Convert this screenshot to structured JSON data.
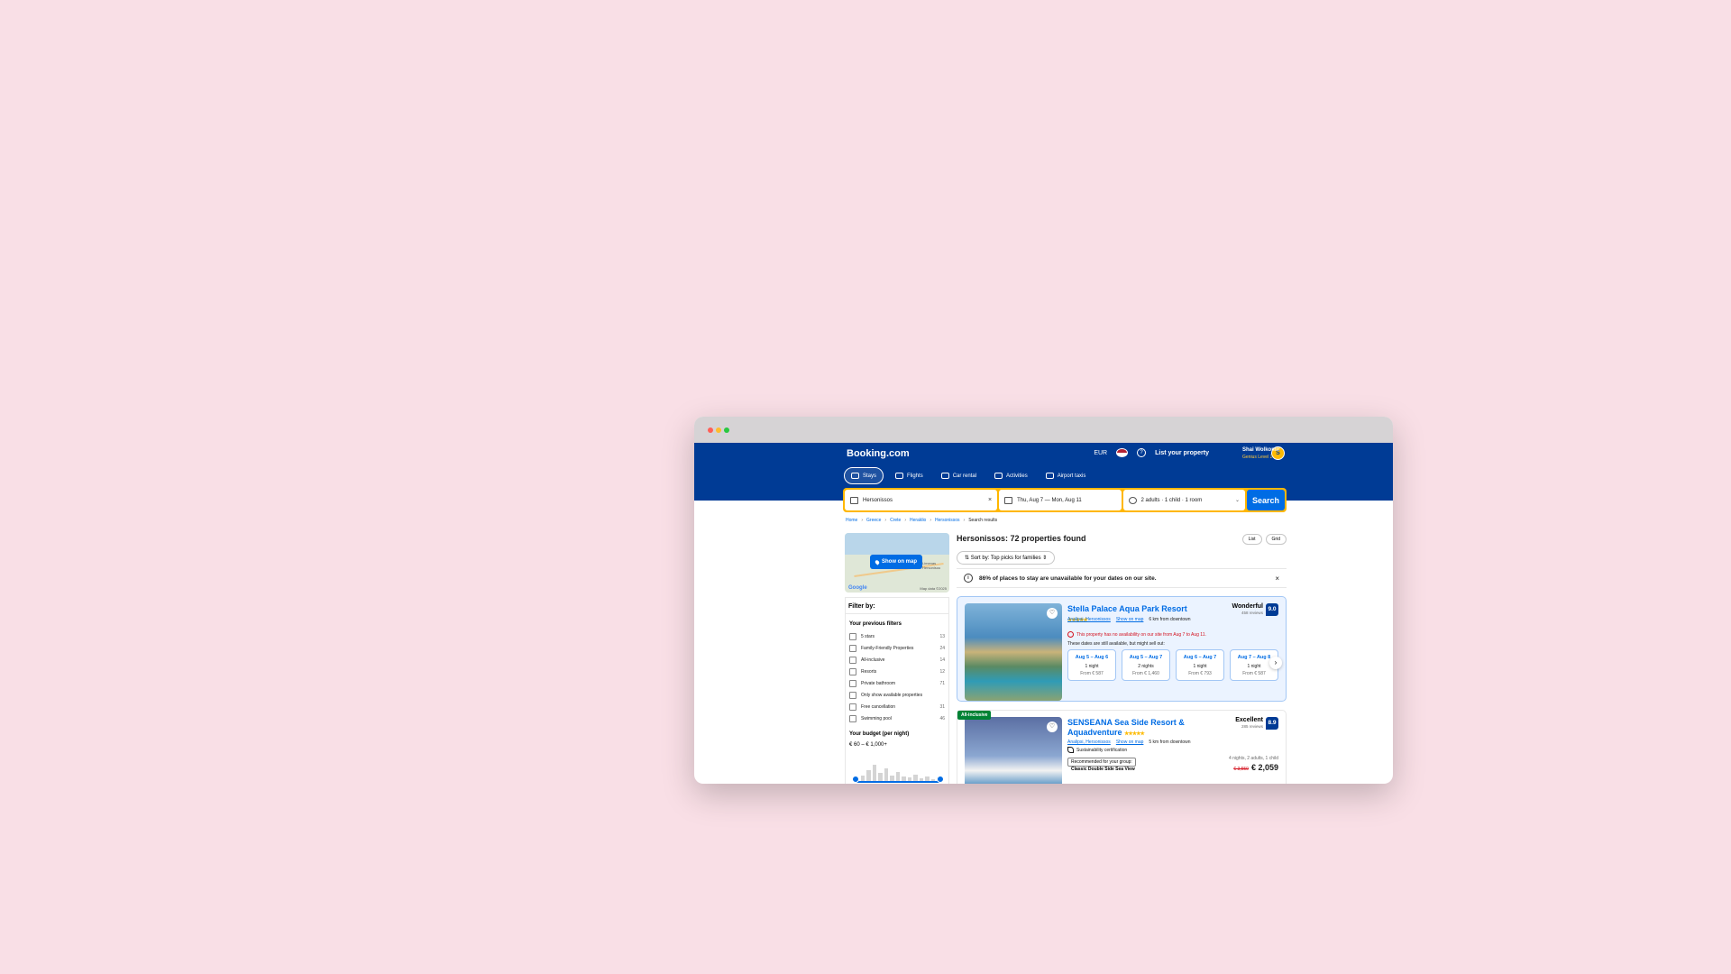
{
  "header": {
    "logo": "Booking.com",
    "currency": "EUR",
    "list_property": "List your property",
    "user_initial": "S",
    "user_name": "Shai Wolkomir",
    "user_level": "Genius Level 2"
  },
  "nav": [
    "Stays",
    "Flights",
    "Car rental",
    "Activities",
    "Airport taxis"
  ],
  "search": {
    "destination": "Hersonissos",
    "dates": "Thu, Aug 7  —  Mon, Aug 11",
    "guests": "2 adults · 1 child · 1 room",
    "button": "Search"
  },
  "breadcrumb": [
    "Home",
    "Greece",
    "Crete",
    "Heraklio",
    "Hersonissos",
    "Search results"
  ],
  "map": {
    "button": "Show on map",
    "label": "Limenas Hersonisou",
    "credit": "Map data ©2025"
  },
  "filters": {
    "title": "Filter by:",
    "previous_title": "Your previous filters",
    "items": [
      {
        "label": "5 stars",
        "count": "13"
      },
      {
        "label": "Family-Friendly Properties",
        "count": "24"
      },
      {
        "label": "All-inclusive",
        "count": "14"
      },
      {
        "label": "Resorts",
        "count": "12"
      },
      {
        "label": "Private bathroom",
        "count": "71"
      },
      {
        "label": "Only show available properties",
        "count": ""
      },
      {
        "label": "Free cancellation",
        "count": "31"
      },
      {
        "label": "Swimming pool",
        "count": "46"
      }
    ],
    "budget_title": "Your budget (per night)",
    "budget_value": "€ 60 – € 1,000+"
  },
  "results": {
    "title": "Hersonissos: 72 properties found",
    "sort": "Sort by: Top picks for families",
    "view_list": "List",
    "view_grid": "Grid",
    "notice": "86% of places to stay are unavailable for your dates on our site."
  },
  "hotel1": {
    "name": "Stella Palace Aqua Park Resort",
    "stars": "★★★★★",
    "location": "Analipsi, Hersonissos",
    "show_on_map": "Show on map",
    "distance": "6 km from downtown",
    "score_word": "Wonderful",
    "reviews": "458 reviews",
    "score": "9.0",
    "warning": "This property has no availability on our site from Aug 7 to Aug 11.",
    "still": "These dates are still available, but might sell out:",
    "dates": [
      {
        "range": "Aug 5 – Aug 6",
        "nights": "1 night",
        "from": "From € 587"
      },
      {
        "range": "Aug 5 – Aug 7",
        "nights": "2 nights",
        "from": "From € 1,460"
      },
      {
        "range": "Aug 6 – Aug 7",
        "nights": "1 night",
        "from": "From € 793"
      },
      {
        "range": "Aug 7 – Aug 8",
        "nights": "1 night",
        "from": "From € 587"
      }
    ]
  },
  "hotel2": {
    "badge": "All-inclusive",
    "name": "SENSEANA Sea Side Resort & Aquadventure",
    "stars": "★★★★★",
    "location": "Analipsi, Hersonissos",
    "show_on_map": "Show on map",
    "distance": "5 km from downtown",
    "score_word": "Excellent",
    "reviews": "285 reviews",
    "score": "8.9",
    "sustainability": "Sustainability certification",
    "recommended": "Recommended for your group:",
    "room": "Classic Double Side Sea View",
    "stay": "4 nights, 2 adults, 1 child",
    "old_price": "€ 3,559",
    "price": "€ 2,059"
  }
}
